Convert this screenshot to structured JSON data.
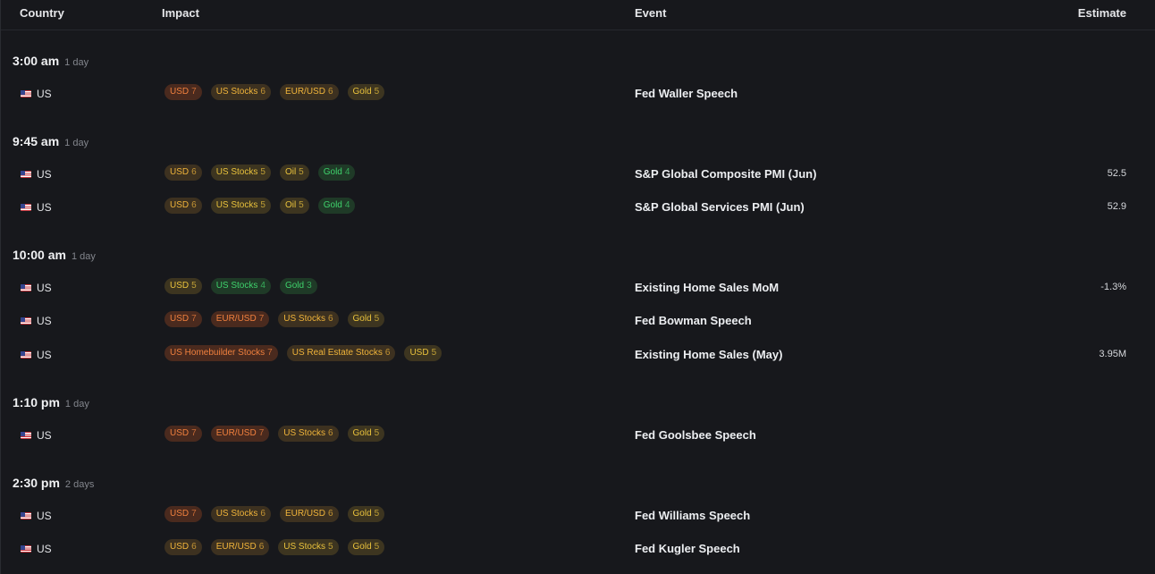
{
  "columns": {
    "country": "Country",
    "impact": "Impact",
    "event": "Event",
    "estimate": "Estimate"
  },
  "colors": {
    "background": "#17181c",
    "impact_high": "#f0803e",
    "impact_med": "#f0b43a",
    "impact_low": "#3fd26c"
  },
  "groups": [
    {
      "time": "3:00 am",
      "relative": "1 day",
      "rows": [
        {
          "country": "US",
          "flag": "us-flag-icon",
          "event": "Fed Waller Speech",
          "estimate": "",
          "tags": [
            {
              "label": "USD",
              "level": "7"
            },
            {
              "label": "US Stocks",
              "level": "6"
            },
            {
              "label": "EUR/USD",
              "level": "6"
            },
            {
              "label": "Gold",
              "level": "5"
            }
          ]
        }
      ]
    },
    {
      "time": "9:45 am",
      "relative": "1 day",
      "rows": [
        {
          "country": "US",
          "flag": "us-flag-icon",
          "event": "S&P Global Composite PMI (Jun)",
          "estimate": "52.5",
          "tags": [
            {
              "label": "USD",
              "level": "6"
            },
            {
              "label": "US Stocks",
              "level": "5"
            },
            {
              "label": "Oil",
              "level": "5"
            },
            {
              "label": "Gold",
              "level": "4"
            }
          ]
        },
        {
          "country": "US",
          "flag": "us-flag-icon",
          "event": "S&P Global Services PMI (Jun)",
          "estimate": "52.9",
          "tags": [
            {
              "label": "USD",
              "level": "6"
            },
            {
              "label": "US Stocks",
              "level": "5"
            },
            {
              "label": "Oil",
              "level": "5"
            },
            {
              "label": "Gold",
              "level": "4"
            }
          ]
        }
      ]
    },
    {
      "time": "10:00 am",
      "relative": "1 day",
      "rows": [
        {
          "country": "US",
          "flag": "us-flag-icon",
          "event": "Existing Home Sales MoM",
          "estimate": "-1.3%",
          "tags": [
            {
              "label": "USD",
              "level": "5"
            },
            {
              "label": "US Stocks",
              "level": "4"
            },
            {
              "label": "Gold",
              "level": "3"
            }
          ]
        },
        {
          "country": "US",
          "flag": "us-flag-icon",
          "event": "Fed Bowman Speech",
          "estimate": "",
          "tags": [
            {
              "label": "USD",
              "level": "7"
            },
            {
              "label": "EUR/USD",
              "level": "7"
            },
            {
              "label": "US Stocks",
              "level": "6"
            },
            {
              "label": "Gold",
              "level": "5"
            }
          ]
        },
        {
          "country": "US",
          "flag": "us-flag-icon",
          "event": "Existing Home Sales (May)",
          "estimate": "3.95M",
          "tags": [
            {
              "label": "US Homebuilder Stocks",
              "level": "7"
            },
            {
              "label": "US Real Estate Stocks",
              "level": "6"
            },
            {
              "label": "USD",
              "level": "5"
            }
          ]
        }
      ]
    },
    {
      "time": "1:10 pm",
      "relative": "1 day",
      "rows": [
        {
          "country": "US",
          "flag": "us-flag-icon",
          "event": "Fed Goolsbee Speech",
          "estimate": "",
          "tags": [
            {
              "label": "USD",
              "level": "7"
            },
            {
              "label": "EUR/USD",
              "level": "7"
            },
            {
              "label": "US Stocks",
              "level": "6"
            },
            {
              "label": "Gold",
              "level": "5"
            }
          ]
        }
      ]
    },
    {
      "time": "2:30 pm",
      "relative": "2 days",
      "rows": [
        {
          "country": "US",
          "flag": "us-flag-icon",
          "event": "Fed Williams Speech",
          "estimate": "",
          "tags": [
            {
              "label": "USD",
              "level": "7"
            },
            {
              "label": "US Stocks",
              "level": "6"
            },
            {
              "label": "EUR/USD",
              "level": "6"
            },
            {
              "label": "Gold",
              "level": "5"
            }
          ]
        },
        {
          "country": "US",
          "flag": "us-flag-icon",
          "event": "Fed Kugler Speech",
          "estimate": "",
          "tags": [
            {
              "label": "USD",
              "level": "6"
            },
            {
              "label": "EUR/USD",
              "level": "6"
            },
            {
              "label": "US Stocks",
              "level": "5"
            },
            {
              "label": "Gold",
              "level": "5"
            }
          ]
        }
      ]
    }
  ]
}
